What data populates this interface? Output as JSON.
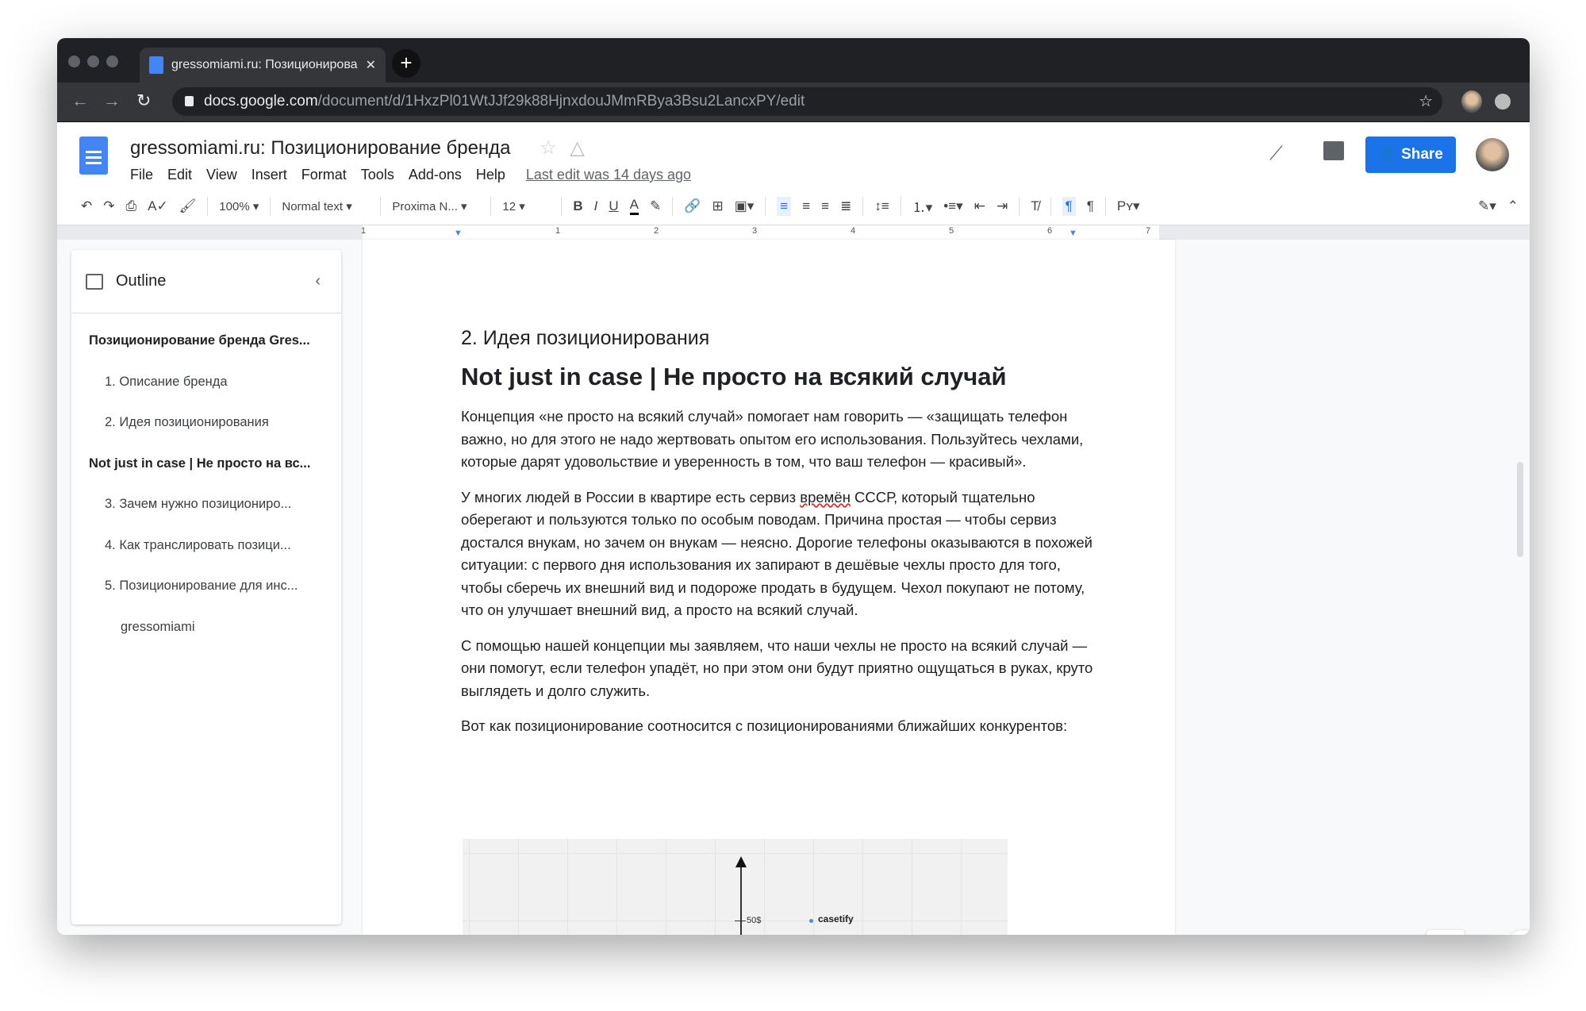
{
  "browser": {
    "tab_title": "gressomiami.ru: Позиционирование бренда",
    "url_host": "docs.google.com",
    "url_path": "/document/d/1HxzPl01WtJJf29k88HjnxdouJMmRBya3Bsu2LancxPY/edit"
  },
  "doc": {
    "title": "gressomiami.ru: Позиционирование бренда",
    "menus": [
      "File",
      "Edit",
      "View",
      "Insert",
      "Format",
      "Tools",
      "Add-ons",
      "Help"
    ],
    "last_edit": "Last edit was 14 days ago",
    "share_label": "Share"
  },
  "toolbar": {
    "zoom": "100%",
    "style": "Normal text",
    "font": "Proxima N...",
    "size": "12"
  },
  "ruler": [
    "1",
    "1",
    "2",
    "3",
    "4",
    "5",
    "6",
    "7"
  ],
  "outline": {
    "title": "Outline",
    "items": [
      {
        "label": "Позиционирование бренда Gres...",
        "level": 0
      },
      {
        "label": "1. Описание бренда",
        "level": 1
      },
      {
        "label": "2. Идея позиционирования",
        "level": 1
      },
      {
        "label": "Not just in case | Не просто на вс...",
        "level": 0
      },
      {
        "label": "3. Зачем нужно позиционирo...",
        "level": 1
      },
      {
        "label": "4. Как транслировать позици...",
        "level": 1
      },
      {
        "label": "5. Позиционирование для инс...",
        "level": 1
      },
      {
        "label": "gressomiami",
        "level": 2
      }
    ]
  },
  "body": {
    "h2": "2. Идея позиционирования",
    "h1": "Not just in case | Не просто на всякий случай",
    "p1": "Концепция «не просто на всякий случай» помогает нам говорить — «защищать телефон важно, но для этого не надо жертвовать опытом его использования. Пользуйтесь чехлами, которые дарят удовольствие и уверенность в том, что ваш телефон — красивый».",
    "p2a": "У многих людей в России в квартире есть сервиз ",
    "p2b": "времён",
    "p2c": " СССР, который тщательно оберегают и пользуются только по особым поводам. Причина простая — чтобы сервиз достался внукам, но зачем он внукам — неясно. Дорогие телефоны оказываются в похожей ситуации: с первого дня использования их запирают в дешёвые чехлы просто для того, чтобы сберечь их внешний вид и подороже продать в будущем. Чехол покупают не потому, что он улучшает внешний вид, а просто на всякий случай.",
    "p3": "С помощью нашей концепции мы заявляем, что наши чехлы не просто на всякий случай — они помогут, если телефон упадёт, но при этом они будут приятно ощущаться в руках, круто выглядеть и долго служить.",
    "p4": "Вот как позиционирование соотносится с позиционированиями ближайших конкурентов:"
  },
  "chart": {
    "tick_label": "50$",
    "point_label": "casetify",
    "point_color": "#4a90e2"
  },
  "colors": {
    "accent": "#1a73e8"
  }
}
